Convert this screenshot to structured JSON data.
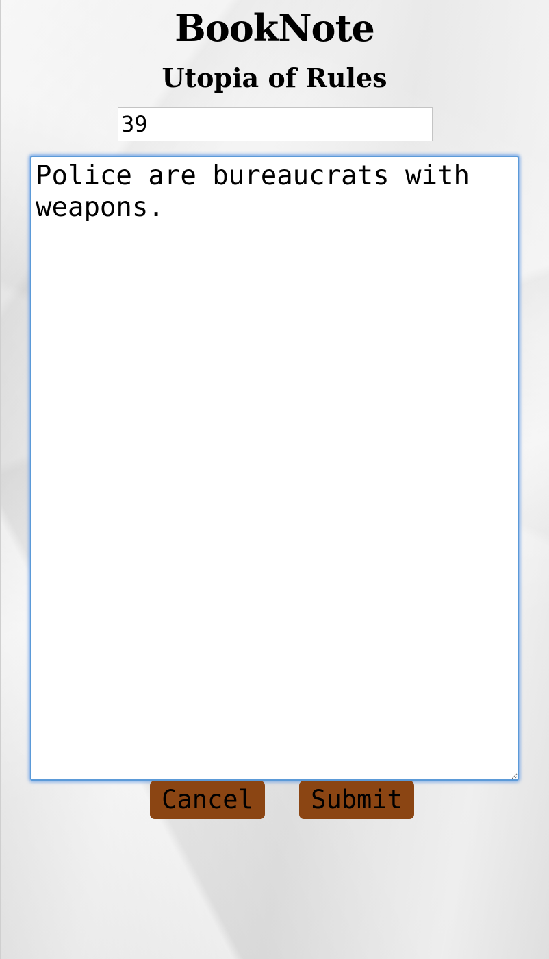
{
  "header": {
    "app_title": "BookNote",
    "book_title": "Utopia of Rules"
  },
  "form": {
    "page_value": "39",
    "note_text": "Police are bureaucrats with weapons.",
    "cancel_label": "Cancel",
    "submit_label": "Submit"
  },
  "colors": {
    "button_background": "#8b4513",
    "focus_ring": "#5b9ad8",
    "page_background": "#ececec"
  }
}
